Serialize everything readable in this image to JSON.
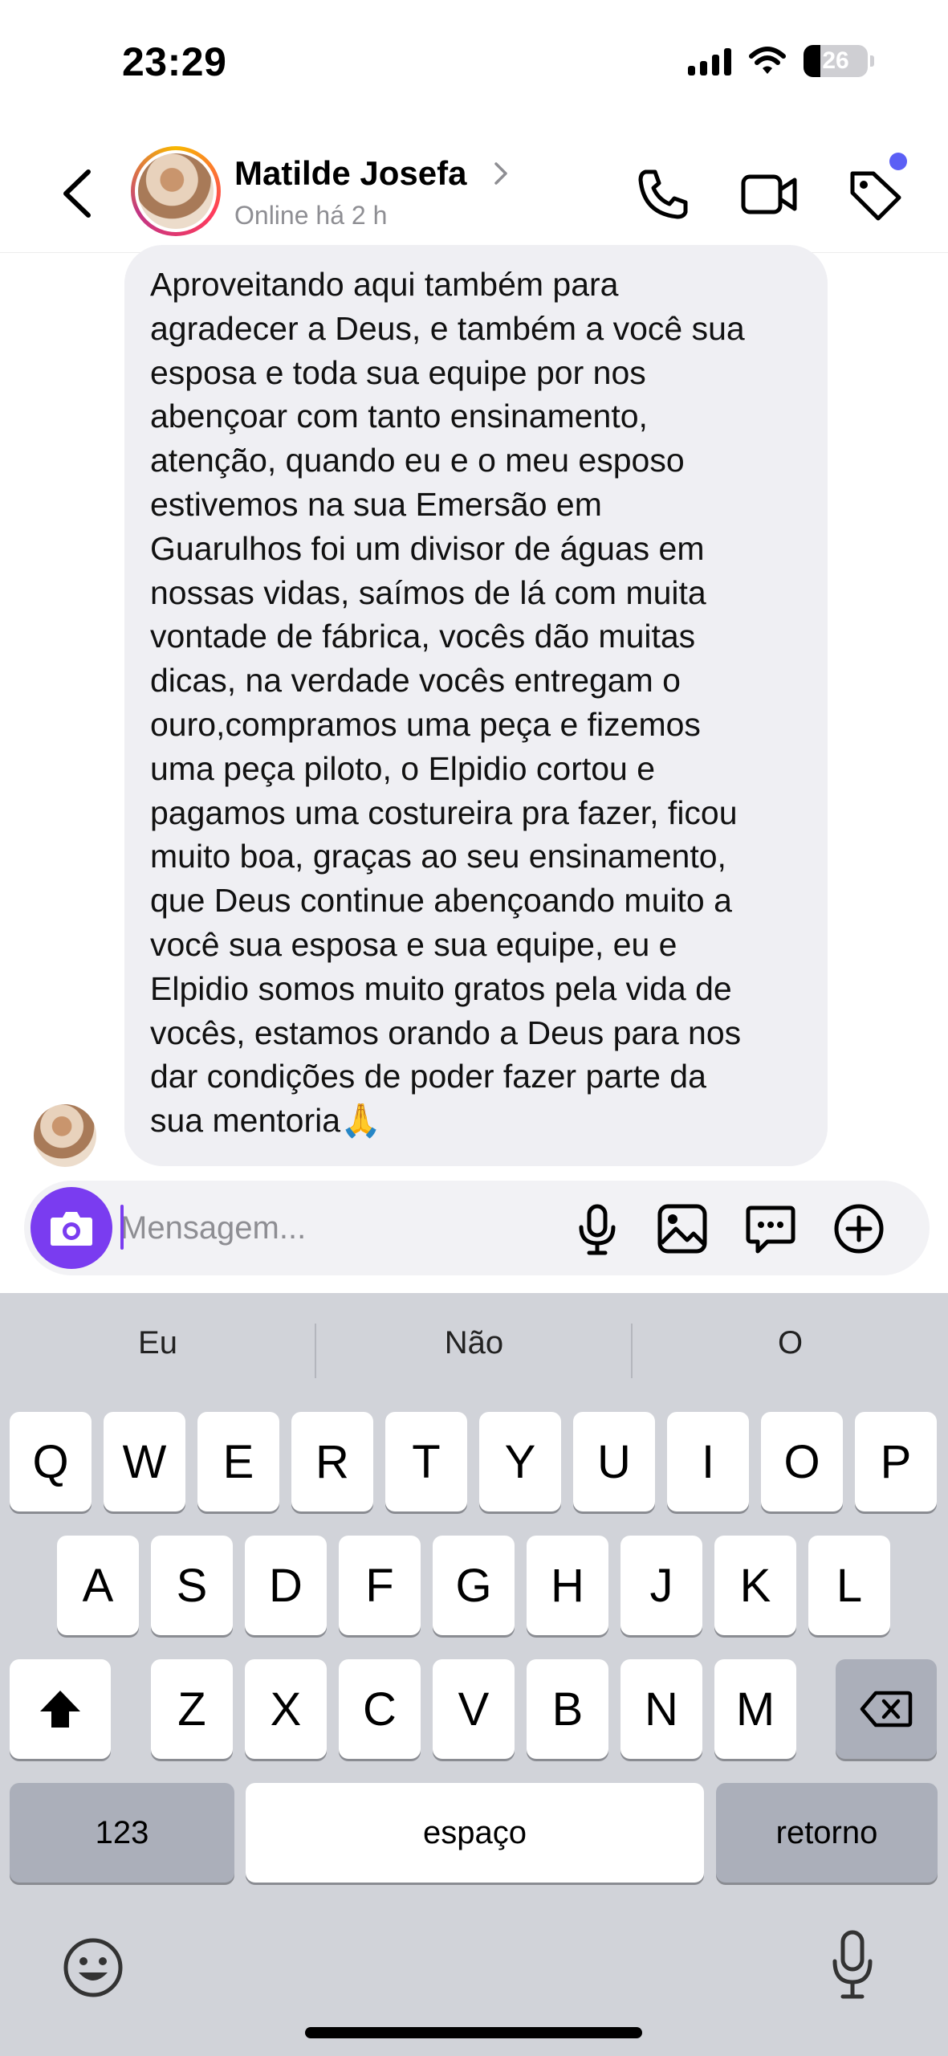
{
  "status_bar": {
    "time": "23:29",
    "battery": "26"
  },
  "header": {
    "contact_name": "Matilde Josefa",
    "contact_status": "Online há 2 h",
    "icons": [
      "back-icon",
      "phone-icon",
      "video-camera-icon",
      "tag-icon"
    ]
  },
  "message": {
    "text": "Aproveitando aqui também para\nagradecer a Deus, e também a você sua\nesposa e toda sua equipe por nos\nabençoar com tanto ensinamento,\natenção, quando eu e o meu esposo\nestivemos na sua Emersão em\nGuarulhos foi um divisor de águas em\nnossas vidas, saímos de lá com muita\nvontade de fábrica, vocês dão muitas\ndicas, na verdade vocês entregam o\nouro,compramos uma peça e fizemos\numa peça piloto, o Elpidio cortou e\npagamos uma costureira pra fazer, ficou\nmuito boa, graças ao seu ensinamento,\nque Deus continue abençoando muito a\nvocê sua esposa e sua equipe, eu e\nElpidio somos muito gratos pela vida de\nvocês, estamos orando a Deus para nos\ndar condições de poder fazer parte da\nsua mentoria🙏"
  },
  "composer": {
    "placeholder": "Mensagem...",
    "value": "",
    "icons": [
      "camera-icon",
      "microphone-icon",
      "image-icon",
      "sticker-icon",
      "plus-icon"
    ],
    "accent_color": "#7a3cf0"
  },
  "keyboard": {
    "suggestions": [
      "Eu",
      "Não",
      "O"
    ],
    "row1": [
      "Q",
      "W",
      "E",
      "R",
      "T",
      "Y",
      "U",
      "I",
      "O",
      "P"
    ],
    "row2": [
      "A",
      "S",
      "D",
      "F",
      "G",
      "H",
      "J",
      "K",
      "L"
    ],
    "row3": [
      "Z",
      "X",
      "C",
      "V",
      "B",
      "N",
      "M"
    ],
    "numbers_label": "123",
    "space_label": "espaço",
    "return_label": "retorno"
  }
}
